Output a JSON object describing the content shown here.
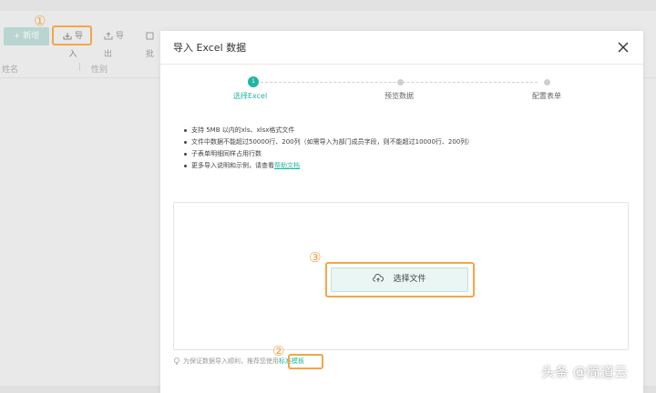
{
  "background": {
    "toolbar": {
      "add": "+ 新增",
      "import": "导入",
      "export": "导出",
      "batch": "批"
    },
    "table_header": {
      "col_a": "姓名",
      "separator": "|",
      "col_b": "性别"
    }
  },
  "annotations": [
    "①",
    "②",
    "③"
  ],
  "modal": {
    "title": "导入 Excel 数据",
    "steps": [
      {
        "number": "1",
        "label": "选择Excel",
        "active": true
      },
      {
        "label": "预览数据",
        "active": false
      },
      {
        "label": "配置表单",
        "active": false
      }
    ],
    "notes": [
      "支持 5MB 以内的xls、xlsx格式文件",
      "文件中数据不能超过50000行、200列（如需导入为部门成员字段，则不能超过10000行、200列）",
      "子表单明细同样占用行数"
    ],
    "more_note_prefix": "更多导入说明和示例，请查看",
    "help_link": "帮助文档",
    "select_file_button": "选择文件",
    "bottom_hint": "为保证数据导入顺利，推荐您使用",
    "template_link": "标准模板"
  },
  "watermark": "头条 @简道云",
  "colors": {
    "accent": "#1fb5a1",
    "annotation": "#f2a64a"
  }
}
